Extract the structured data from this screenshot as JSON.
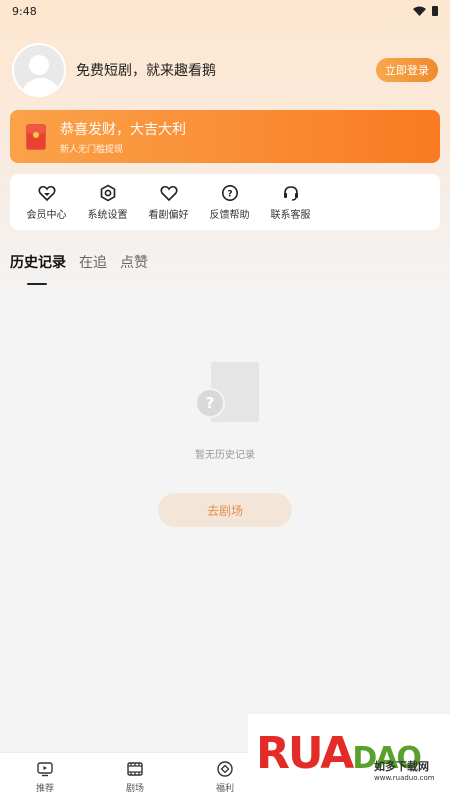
{
  "status_bar": {
    "time": "9:48"
  },
  "profile": {
    "name": "免费短剧，就来趣看鹅",
    "login_label": "立即登录"
  },
  "banner": {
    "title": "恭喜发财，大吉大利",
    "subtitle": "新人无门槛提现"
  },
  "menu": [
    {
      "label": "会员中心",
      "icon": "vip-heart-icon"
    },
    {
      "label": "系统设置",
      "icon": "settings-hex-icon"
    },
    {
      "label": "看剧偏好",
      "icon": "heart-icon"
    },
    {
      "label": "反馈帮助",
      "icon": "help-question-icon"
    },
    {
      "label": "联系客服",
      "icon": "headset-icon"
    }
  ],
  "tabs": [
    {
      "label": "历史记录",
      "active": true
    },
    {
      "label": "在追",
      "active": false
    },
    {
      "label": "点赞",
      "active": false
    }
  ],
  "empty_state": {
    "message": "暂无历史记录",
    "action_label": "去剧场"
  },
  "bottom_nav": [
    {
      "label": "推荐",
      "icon": "tv-icon"
    },
    {
      "label": "剧场",
      "icon": "film-icon"
    },
    {
      "label": "福利",
      "icon": "coin-icon"
    }
  ],
  "watermark": {
    "logo": "RUANDAO",
    "name": "如多下载网",
    "url": "www.ruaduo.com"
  },
  "colors": {
    "accent": "#f98b33",
    "button_bg": "#f3e5d7",
    "button_text": "#e6914f"
  }
}
